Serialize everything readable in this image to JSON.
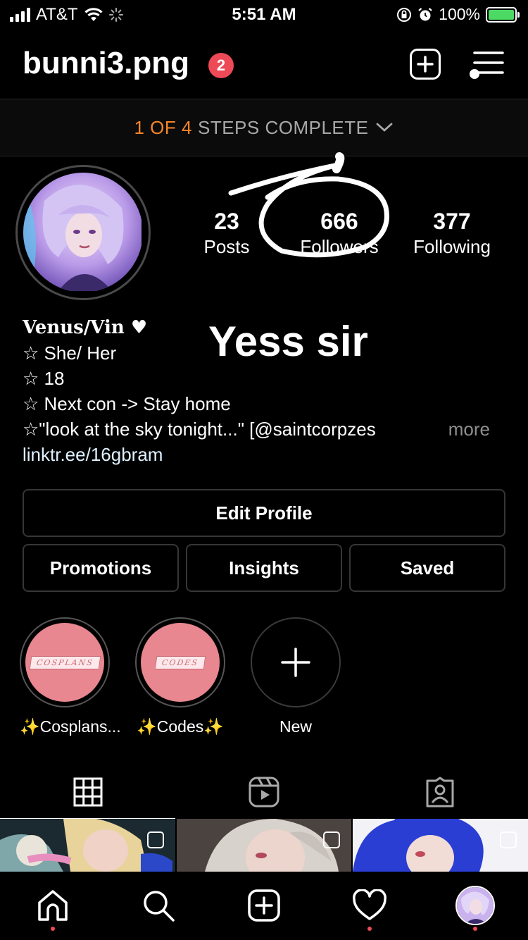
{
  "status_bar": {
    "carrier": "AT&T",
    "time": "5:51 AM",
    "battery_percent": "100%",
    "battery_level": 1.0
  },
  "header": {
    "username": "bunni3.png",
    "notification_count": "2"
  },
  "steps": {
    "progress_text": "1 OF 4",
    "status_text": "STEPS COMPLETE"
  },
  "stats": {
    "posts": {
      "value": "23",
      "label": "Posts"
    },
    "followers": {
      "value": "666",
      "label": "Followers"
    },
    "following": {
      "value": "377",
      "label": "Following"
    }
  },
  "overlay_caption": "Yess sir",
  "bio": {
    "display_name": "Venus/Vin ♥",
    "lines": [
      "☆ She/ Her",
      "☆ 18",
      "☆ Next con -> Stay home",
      "☆\"look at the sky tonight...\" [@saintcorpzes"
    ],
    "more_label": "more",
    "link": "linktr.ee/16gbram"
  },
  "buttons": {
    "edit_profile": "Edit Profile",
    "promotions": "Promotions",
    "insights": "Insights",
    "saved": "Saved"
  },
  "highlights": [
    {
      "label": "✨Cosplans...",
      "cover_text": "COSPLANS"
    },
    {
      "label": "✨Codes✨",
      "cover_text": "CODES"
    },
    {
      "label": "New"
    }
  ],
  "tabs": [
    "grid-icon",
    "reels-icon",
    "tagged-icon"
  ],
  "colors": {
    "accent_orange": "#f58529",
    "badge_red": "#ed4956",
    "highlight_pink": "#e8878f"
  }
}
